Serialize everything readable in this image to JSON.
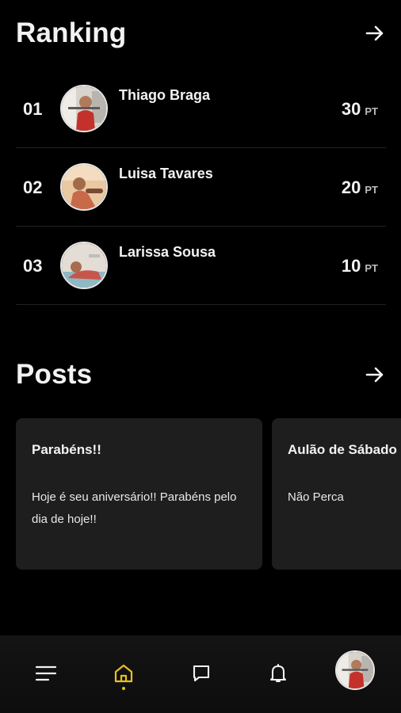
{
  "ranking": {
    "title": "Ranking",
    "rows": [
      {
        "position": "01",
        "name": "Thiago Braga",
        "score": "30",
        "unit": "PT"
      },
      {
        "position": "02",
        "name": "Luisa Tavares",
        "score": "20",
        "unit": "PT"
      },
      {
        "position": "03",
        "name": "Larissa Sousa",
        "score": "10",
        "unit": "PT"
      }
    ]
  },
  "posts": {
    "title": "Posts",
    "cards": [
      {
        "title": "Parabéns!!",
        "body": "Hoje é seu aniversário!!  Parabéns pelo dia de hoje!!"
      },
      {
        "title": "Aulão de Sábado",
        "body": "Não Perca"
      }
    ]
  },
  "nav": {
    "items": [
      {
        "icon": "menu-icon",
        "active": false
      },
      {
        "icon": "home-icon",
        "active": true
      },
      {
        "icon": "chat-icon",
        "active": false
      },
      {
        "icon": "bell-icon",
        "active": false
      },
      {
        "icon": "profile-avatar",
        "active": false
      }
    ]
  },
  "colors": {
    "background": "#000000",
    "card": "#1e1e1e",
    "accent": "#e8c21a",
    "text": "#f2f2f2"
  }
}
